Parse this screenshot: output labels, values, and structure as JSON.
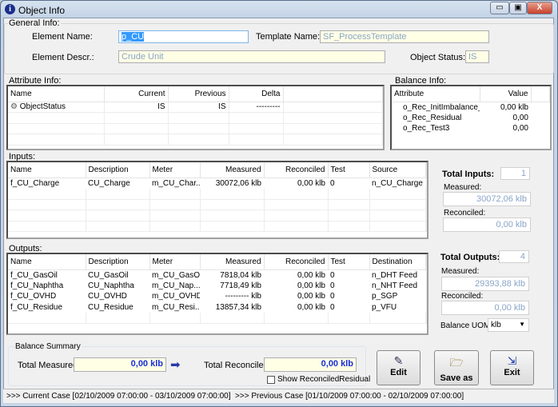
{
  "window": {
    "title": "Object Info",
    "minimize": "▭",
    "maximize": "▣",
    "close": "X"
  },
  "general": {
    "label": "General Info:",
    "element_name_label": "Element Name:",
    "element_name": "p_CU",
    "template_name_label": "Template Name:",
    "template_name": "SF_ProcessTemplate",
    "element_descr_label": "Element Descr.:",
    "element_descr": "Crude Unit",
    "object_status_label": "Object Status:",
    "object_status": "IS"
  },
  "attribute_info": {
    "label": "Attribute Info:",
    "columns": [
      "Name",
      "Current",
      "Previous",
      "Delta"
    ],
    "rows": [
      {
        "name": "ObjectStatus",
        "current": "IS",
        "previous": "IS",
        "delta": "---------"
      }
    ]
  },
  "balance_info": {
    "label": "Balance Info:",
    "columns": [
      "Attribute",
      "Value"
    ],
    "rows": [
      {
        "attribute": "o_Rec_InitImbalance_...",
        "value": "0,00 klb"
      },
      {
        "attribute": "o_Rec_Residual",
        "value": "0,00"
      },
      {
        "attribute": "o_Rec_Test3",
        "value": "0,00"
      }
    ]
  },
  "inputs": {
    "label": "Inputs:",
    "columns": [
      "Name",
      "Description",
      "Meter",
      "Measured",
      "Reconciled",
      "Test",
      "Source"
    ],
    "rows": [
      [
        "f_CU_Charge",
        "CU_Charge",
        "m_CU_Char...",
        "30072,06 klb",
        "0,00 klb",
        "0",
        "n_CU_Charge"
      ]
    ],
    "total_label": "Total Inputs:",
    "total": "1",
    "measured_label": "Measured:",
    "measured": "30072,06 klb",
    "reconciled_label": "Reconciled:",
    "reconciled": "0,00 klb"
  },
  "outputs": {
    "label": "Outputs:",
    "columns": [
      "Name",
      "Description",
      "Meter",
      "Measured",
      "Reconciled",
      "Test",
      "Destination"
    ],
    "rows": [
      [
        "f_CU_GasOil",
        "CU_GasOil",
        "m_CU_GasOil",
        "7818,04 klb",
        "0,00 klb",
        "0",
        "n_DHT Feed"
      ],
      [
        "f_CU_Naphtha",
        "CU_Naphtha",
        "m_CU_Nap...",
        "7718,49 klb",
        "0,00 klb",
        "0",
        "n_NHT Feed"
      ],
      [
        "f_CU_OVHD",
        "CU_OVHD",
        "m_CU_OVHD",
        "--------- klb",
        "0,00 klb",
        "0",
        "p_SGP"
      ],
      [
        "f_CU_Residue",
        "CU_Residue",
        "m_CU_Resi...",
        "13857,34 klb",
        "0,00 klb",
        "0",
        "p_VFU"
      ]
    ],
    "total_label": "Total Outputs:",
    "total": "4",
    "measured_label": "Measured:",
    "measured": "29393,88 klb",
    "reconciled_label": "Reconciled:",
    "reconciled": "0,00 klb",
    "uom_label": "Balance UOM",
    "uom": "klb"
  },
  "summary": {
    "label": "Balance Summary",
    "total_measured_label": "Total Measured:",
    "total_measured": "0,00 klb",
    "total_reconciled_label": "Total Reconciled:",
    "total_reconciled": "0,00 klb",
    "show_residual_label": "Show ReconciledResidual",
    "show_residual_checked": false
  },
  "buttons": {
    "edit": "Edit",
    "save_as": "Save as",
    "exit": "Exit"
  },
  "status": {
    "text": ">>> Current Case [02/10/2009 07:00:00 - 03/10/2009 07:00:00]  >>> Previous Case [01/10/2009 07:00:00 - 02/10/2009 07:00:00]"
  }
}
